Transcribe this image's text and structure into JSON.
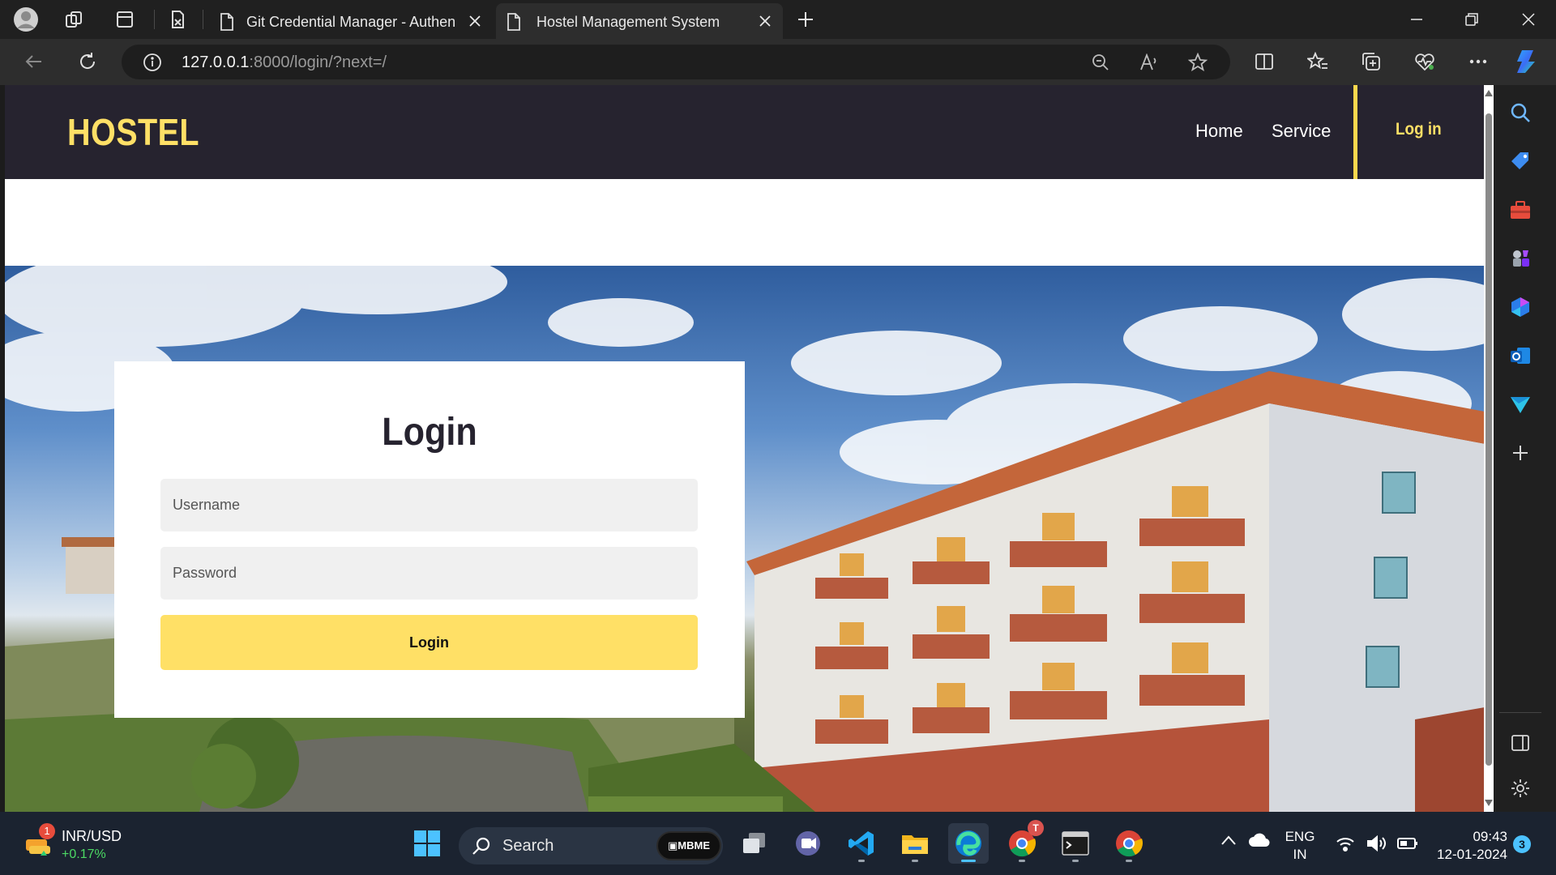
{
  "browser": {
    "tabs": [
      {
        "title": "Git Credential Manager - Authen",
        "active": false
      },
      {
        "title": "Hostel Management System",
        "active": true
      }
    ],
    "url_host": "127.0.0.1",
    "url_rest": ":8000/login/?next=/"
  },
  "site": {
    "brand": "HOSTEL",
    "nav": {
      "home": "Home",
      "service": "Service",
      "login": "Log in"
    },
    "accent": "#ffe066",
    "nav_bg": "#26232f"
  },
  "login": {
    "title": "Login",
    "username_placeholder": "Username",
    "password_placeholder": "Password",
    "button": "Login"
  },
  "taskbar": {
    "widget_title": "INR/USD",
    "widget_change": "+0.17%",
    "widget_badge": "1",
    "search_label": "Search",
    "chrome_badge": "T",
    "lang_top": "ENG",
    "lang_bottom": "IN",
    "time": "09:43",
    "date": "12-01-2024",
    "notification_count": "3"
  }
}
